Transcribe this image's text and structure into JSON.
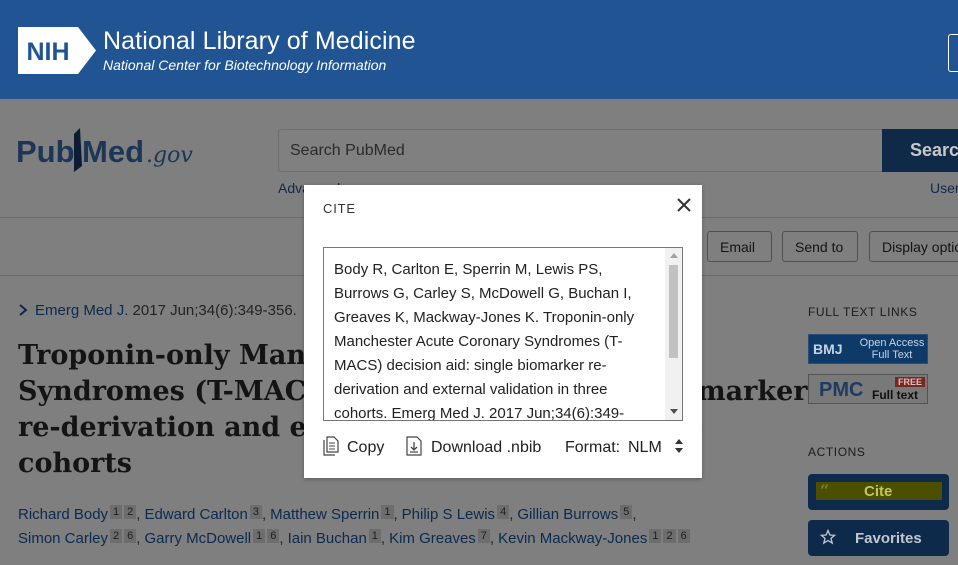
{
  "banner": {
    "logo_text": "NIH",
    "title": "National Library of Medicine",
    "subtitle": "National Center for Biotechnology Information"
  },
  "search": {
    "logo_text": "PubMed.gov",
    "placeholder": "Search PubMed",
    "button_label": "Search",
    "advanced_label": "Advanced",
    "user_guide_label": "User"
  },
  "toolbar": {
    "email_label": "Email",
    "send_to_label": "Send to",
    "display_options_label": "Display options"
  },
  "article": {
    "journal": "Emerg Med J.",
    "citation": "2017 Jun;34(6):349-356.",
    "title_lines": [
      "Troponin-only Manchester Acute Coronary",
      "Syndromes (T-MACS) decision aid: single biomarker",
      "re-derivation and external validation in three",
      "cohorts"
    ],
    "authors": [
      {
        "name": "Richard Body",
        "aff": [
          "1",
          "2"
        ]
      },
      {
        "name": "Edward Carlton",
        "aff": [
          "3"
        ]
      },
      {
        "name": "Matthew Sperrin",
        "aff": [
          "1"
        ]
      },
      {
        "name": "Philip S Lewis",
        "aff": [
          "4"
        ]
      },
      {
        "name": "Gillian Burrows",
        "aff": [
          "5"
        ]
      },
      {
        "name": "Simon Carley",
        "aff": [
          "2",
          "6"
        ]
      },
      {
        "name": "Garry McDowell",
        "aff": [
          "1",
          "6"
        ]
      },
      {
        "name": "Iain Buchan",
        "aff": [
          "1"
        ]
      },
      {
        "name": "Kim Greaves",
        "aff": [
          "7"
        ]
      },
      {
        "name": "Kevin Mackway-Jones",
        "aff": [
          "1",
          "2",
          "6"
        ]
      }
    ]
  },
  "sidebar": {
    "full_text_heading": "FULL TEXT LINKS",
    "bmj_logo": "BMJ",
    "bmj_line1": "Open Access",
    "bmj_line2": "Full Text",
    "pmc_logo": "PMC",
    "pmc_free": "FREE",
    "pmc_full_text": "Full text",
    "actions_heading": "ACTIONS",
    "cite_label": "Cite",
    "favorites_label": "Favorites"
  },
  "cite_dialog": {
    "title": "CITE",
    "citation_lines": [
      "Body R, Carlton E, Sperrin M, Lewis PS,",
      "Burrows G, Carley S, McDowell G, Buchan I,",
      "Greaves K, Mackway-Jones K. Troponin-only",
      "Manchester Acute Coronary Syndromes (T-",
      "MACS) decision aid: single biomarker re-",
      "derivation and external validation in three",
      "cohorts. Emerg Med J. 2017 Jun;34(6):349-"
    ],
    "copy_label": "Copy",
    "download_label": "Download .nbib",
    "format_label": "Format:",
    "format_value": "NLM"
  },
  "colors": {
    "nih_blue": "#205493",
    "pubmed_navy": "#0e2a4a",
    "overlay_gray": "#7f7f7f"
  }
}
